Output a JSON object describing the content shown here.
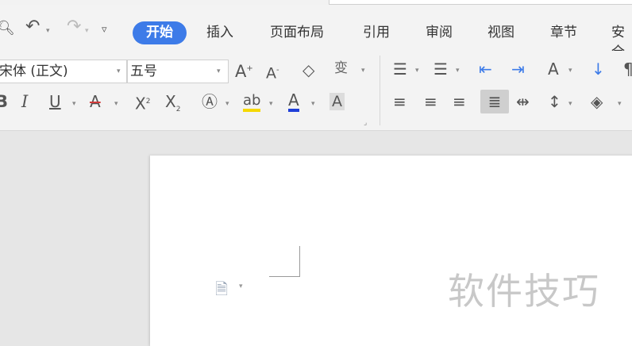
{
  "menubar": {
    "tabs": [
      {
        "label": "开始",
        "active": true
      },
      {
        "label": "插入"
      },
      {
        "label": "页面布局"
      },
      {
        "label": "引用"
      },
      {
        "label": "审阅"
      },
      {
        "label": "视图"
      },
      {
        "label": "章节"
      },
      {
        "label": "安全"
      }
    ]
  },
  "ribbon": {
    "font_name": "宋体 (正文)",
    "font_size": "五号"
  },
  "document": {
    "watermark": "软件技巧"
  },
  "colors": {
    "accent": "#3d7be8",
    "highlight_yellow": "#f5d800",
    "font_color_blue": "#1f3fd8",
    "font_color_red": "#d23a3a"
  }
}
